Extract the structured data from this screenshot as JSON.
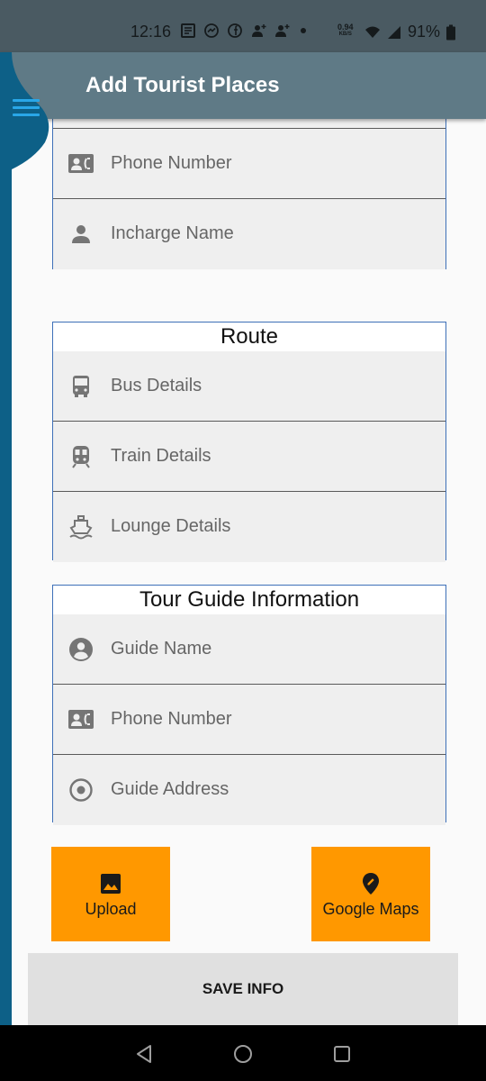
{
  "status_bar": {
    "time": "12:16",
    "net_speed_value": "0.94",
    "net_speed_unit": "KB/S",
    "battery": "91%",
    "icons": [
      "notes-icon",
      "messenger-icon",
      "facebook-icon",
      "person-add-icon",
      "person-add-icon",
      "dot-icon",
      "wifi-icon",
      "signal-icon",
      "battery-icon"
    ]
  },
  "app_bar": {
    "title": "Add Tourist Places",
    "menu_icon": "hamburger-menu-icon"
  },
  "contact_section": {
    "fields": [
      {
        "label": "Phone Number",
        "icon": "contact-phone-icon"
      },
      {
        "label": "Incharge Name",
        "icon": "person-icon"
      }
    ]
  },
  "route_section": {
    "title": "Route",
    "fields": [
      {
        "label": "Bus Details",
        "icon": "bus-icon"
      },
      {
        "label": "Train Details",
        "icon": "train-icon"
      },
      {
        "label": "Lounge Details",
        "icon": "ferry-icon"
      }
    ]
  },
  "guide_section": {
    "title": "Tour Guide Information",
    "fields": [
      {
        "label": "Guide Name",
        "icon": "account-circle-icon"
      },
      {
        "label": "Phone Number",
        "icon": "contact-phone-icon"
      },
      {
        "label": "Guide Address",
        "icon": "radio-button-icon"
      }
    ]
  },
  "actions": {
    "upload": {
      "label": "Upload",
      "icon": "image-icon"
    },
    "maps": {
      "label": "Google Maps",
      "icon": "edit-location-icon"
    },
    "save": {
      "label": "SAVE INFO"
    }
  },
  "colors": {
    "app_bar": "#5f7a86",
    "status_bar": "#4a5a62",
    "side_strip": "#0d6087",
    "menu_icon": "#29a7e8",
    "card_border": "#3e70b8",
    "action_button": "#ff9800",
    "save_button": "#e0e0e0",
    "field_background": "#efefef"
  }
}
